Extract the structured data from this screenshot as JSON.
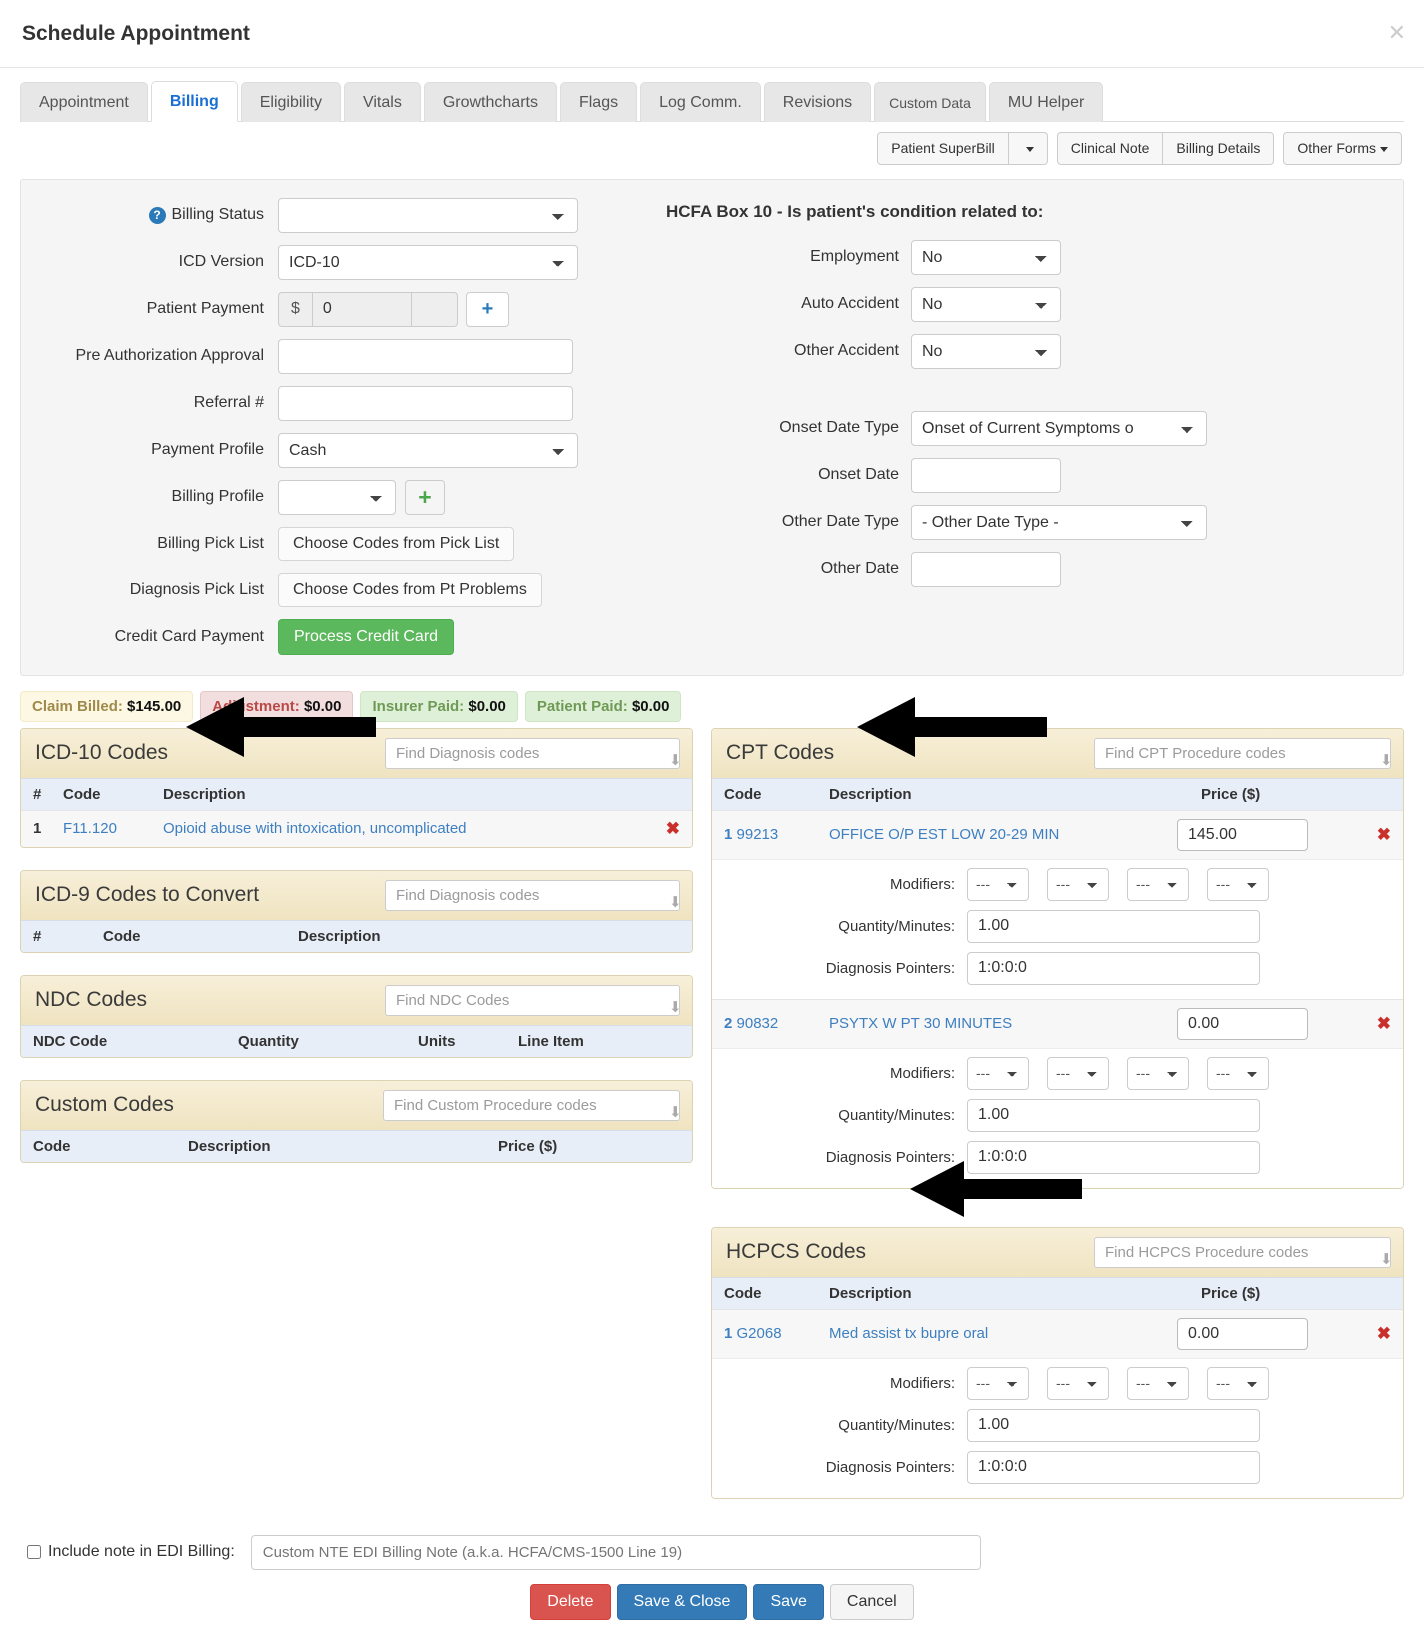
{
  "window": {
    "title": "Schedule Appointment",
    "close_label": "✕"
  },
  "tabs": [
    {
      "label": "Appointment",
      "active": false
    },
    {
      "label": "Billing",
      "active": true
    },
    {
      "label": "Eligibility",
      "active": false
    },
    {
      "label": "Vitals",
      "active": false
    },
    {
      "label": "Growthcharts",
      "active": false
    },
    {
      "label": "Flags",
      "active": false
    },
    {
      "label": "Log Comm.",
      "active": false
    },
    {
      "label": "Revisions",
      "active": false
    },
    {
      "label": "Custom Data",
      "active": false
    },
    {
      "label": "MU Helper",
      "active": false
    }
  ],
  "form_buttons": {
    "patient_superbill": "Patient SuperBill",
    "superbill_caret": "▼",
    "clinical_note": "Clinical Note",
    "billing_details": "Billing Details",
    "other_forms": "Other Forms"
  },
  "billing_form": {
    "help_icon_glyph": "?",
    "billing_status_label": "Billing Status",
    "billing_status_value": "",
    "icd_version_label": "ICD Version",
    "icd_version_value": "ICD-10",
    "patient_payment_label": "Patient Payment",
    "patient_payment_currency": "$",
    "patient_payment_value": "0",
    "patient_payment_add": "+",
    "pre_auth_label": "Pre Authorization Approval",
    "pre_auth_value": "",
    "referral_label": "Referral #",
    "referral_value": "",
    "payment_profile_label": "Payment Profile",
    "payment_profile_value": "Cash",
    "billing_profile_label": "Billing Profile",
    "billing_profile_value": "",
    "billing_profile_add": "+",
    "billing_pick_list_label": "Billing Pick List",
    "billing_pick_list_button": "Choose Codes from Pick List",
    "diagnosis_pick_list_label": "Diagnosis Pick List",
    "diagnosis_pick_list_button": "Choose Codes from Pt Problems",
    "credit_card_label": "Credit Card Payment",
    "credit_card_button": "Process Credit Card"
  },
  "hcfa": {
    "title": "HCFA Box 10 - Is patient's condition related to:",
    "employment_label": "Employment",
    "employment_value": "No",
    "auto_accident_label": "Auto Accident",
    "auto_accident_value": "No",
    "other_accident_label": "Other Accident",
    "other_accident_value": "No",
    "onset_date_type_label": "Onset Date Type",
    "onset_date_type_value": "Onset of Current Symptoms o",
    "onset_date_label": "Onset Date",
    "onset_date_value": "",
    "other_date_type_label": "Other Date Type",
    "other_date_type_value": "- Other Date Type -",
    "other_date_label": "Other Date",
    "other_date_value": ""
  },
  "totals": [
    {
      "label": "Claim Billed:",
      "value": "$145.00",
      "style": "b-billed"
    },
    {
      "label": "Adjustment:",
      "value": "$0.00",
      "style": "b-adj"
    },
    {
      "label": "Insurer Paid:",
      "value": "$0.00",
      "style": "b-ins"
    },
    {
      "label": "Patient Paid:",
      "value": "$0.00",
      "style": "b-pat"
    }
  ],
  "icd10": {
    "title": "ICD-10 Codes",
    "search_placeholder": "Find Diagnosis codes",
    "headers": {
      "num": "#",
      "code": "Code",
      "description": "Description"
    },
    "rows": [
      {
        "num": "1",
        "code": "F11.120",
        "description": "Opioid abuse with intoxication, uncomplicated",
        "delete": "✖"
      }
    ]
  },
  "icd9": {
    "title": "ICD-9 Codes to Convert",
    "search_placeholder": "Find Diagnosis codes",
    "headers": {
      "num": "#",
      "code": "Code",
      "description": "Description"
    }
  },
  "ndc": {
    "title": "NDC Codes",
    "search_placeholder": "Find NDC Codes",
    "headers": {
      "code": "NDC Code",
      "quantity": "Quantity",
      "units": "Units",
      "line_item": "Line Item"
    }
  },
  "custom": {
    "title": "Custom Codes",
    "search_placeholder": "Find Custom Procedure codes",
    "headers": {
      "code": "Code",
      "description": "Description",
      "price": "Price ($)"
    }
  },
  "cpt": {
    "title": "CPT Codes",
    "search_placeholder": "Find CPT Procedure codes",
    "headers": {
      "code": "Code",
      "description": "Description",
      "price": "Price ($)"
    },
    "modifiers_label": "Modifiers:",
    "quantity_label": "Quantity/Minutes:",
    "pointers_label": "Diagnosis Pointers:",
    "modifier_value": "---",
    "rows": [
      {
        "num": "1",
        "code": "99213",
        "description": "OFFICE O/P EST LOW 20-29 MIN",
        "price": "145.00",
        "delete": "✖",
        "quantity": "1.00",
        "pointers": "1:0:0:0"
      },
      {
        "num": "2",
        "code": "90832",
        "description": "PSYTX W PT 30 MINUTES",
        "price": "0.00",
        "delete": "✖",
        "quantity": "1.00",
        "pointers": "1:0:0:0"
      }
    ]
  },
  "hcpcs": {
    "title": "HCPCS Codes",
    "search_placeholder": "Find HCPCS Procedure codes",
    "headers": {
      "code": "Code",
      "description": "Description",
      "price": "Price ($)"
    },
    "modifiers_label": "Modifiers:",
    "quantity_label": "Quantity/Minutes:",
    "pointers_label": "Diagnosis Pointers:",
    "modifier_value": "---",
    "rows": [
      {
        "num": "1",
        "code": "G2068",
        "description": "Med assist tx bupre oral",
        "price": "0.00",
        "delete": "✖",
        "quantity": "1.00",
        "pointers": "1:0:0:0"
      }
    ]
  },
  "footer": {
    "edi_checkbox_label": "Include note in EDI Billing:",
    "edi_placeholder": "Custom NTE EDI Billing Note (a.k.a. HCFA/CMS-1500 Line 19)",
    "edi_value": "",
    "delete": "Delete",
    "save_close": "Save & Close",
    "save": "Save",
    "cancel": "Cancel"
  },
  "colors": {
    "accent_blue": "#3d7fc1",
    "section_header": "#efe3c0",
    "table_header": "#e8eef7",
    "green_button": "#5cb85c",
    "danger": "#d9534f",
    "primary": "#337ab7"
  }
}
